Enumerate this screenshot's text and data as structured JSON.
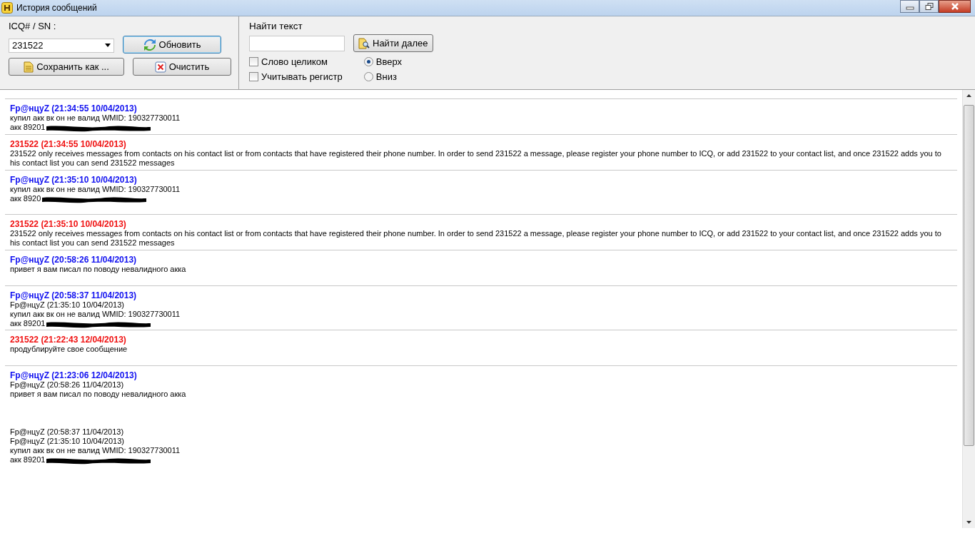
{
  "window": {
    "title": "История сообщений"
  },
  "contact": {
    "label": "ICQ# / SN :",
    "value": "231522"
  },
  "buttons": {
    "refresh": "Обновить",
    "save": "Сохранить как ...",
    "clear": "Очистить"
  },
  "search": {
    "label": "Найти текст",
    "find_next": "Найти далее",
    "options": [
      {
        "label": "Слово целиком",
        "checked": false
      },
      {
        "label": "Учитывать регистр",
        "checked": false
      }
    ],
    "direction": [
      {
        "label": "Вверх",
        "selected": true
      },
      {
        "label": "Вниз",
        "selected": false
      }
    ]
  },
  "messages": [
    {
      "kind": "contact",
      "header": "Fp@нцуZ (21:34:55 10/04/2013)",
      "lines": [
        {
          "text": "купил акк вк он не валид WMID: 190327730011",
          "redacted": false
        },
        {
          "text": "акк 89201",
          "redacted": true
        }
      ]
    },
    {
      "kind": "me",
      "header": "231522 (21:34:55 10/04/2013)",
      "lines": [
        {
          "text": "231522 only receives messages from contacts on his contact list or from contacts that have registered their phone number. In order to send 231522 a message, please register your phone number to ICQ, or add 231522 to your contact list, and once 231522 adds you to his contact list you can send 231522 messages",
          "redacted": false
        }
      ]
    },
    {
      "kind": "contact",
      "header": "Fp@нцуZ (21:35:10 10/04/2013)",
      "lines": [
        {
          "text": "купил акк вк он не валид WMID: 190327730011",
          "redacted": false
        },
        {
          "text": "акк 8920",
          "redacted": true
        }
      ]
    },
    {
      "kind": "me",
      "header": "231522 (21:35:10 10/04/2013)",
      "lines": [
        {
          "text": "231522 only receives messages from contacts on his contact list or from contacts that have registered their phone number. In order to send 231522 a message, please register your phone number to ICQ, or add 231522 to your contact list, and once 231522 adds you to his contact list you can send 231522 messages",
          "redacted": false
        }
      ]
    },
    {
      "kind": "contact",
      "header": "Fp@нцуZ (20:58:26 11/04/2013)",
      "lines": [
        {
          "text": "привет я вам писал по поводу невалидного акка",
          "redacted": false
        }
      ]
    },
    {
      "kind": "contact",
      "header": "Fp@нцуZ (20:58:37 11/04/2013)",
      "lines": [
        {
          "text": " Fp@нцуZ (21:35:10 10/04/2013)",
          "redacted": false
        },
        {
          "text": "купил акк вк он не валид WMID: 190327730011",
          "redacted": false
        },
        {
          "text": "акк 89201",
          "redacted": true
        }
      ]
    },
    {
      "kind": "me",
      "header": "231522 (21:22:43 12/04/2013)",
      "lines": [
        {
          "text": "продублируйте свое сообщение",
          "redacted": false
        }
      ]
    },
    {
      "kind": "contact",
      "header": "Fp@нцуZ (21:23:06 12/04/2013)",
      "lines": [
        {
          "text": "Fp@нцуZ (20:58:26 11/04/2013)",
          "redacted": false
        },
        {
          "text": "привет я вам писал по поводу невалидного акка",
          "redacted": false
        },
        {
          "text": "Fp@нцуZ (20:58:37 11/04/2013)",
          "redacted": false,
          "gap_before": true
        },
        {
          "text": " Fp@нцуZ (21:35:10 10/04/2013)",
          "redacted": false
        },
        {
          "text": "купил акк вк он не валид WMID: 190327730011",
          "redacted": false
        },
        {
          "text": "акк 89201",
          "redacted": true
        }
      ]
    }
  ]
}
